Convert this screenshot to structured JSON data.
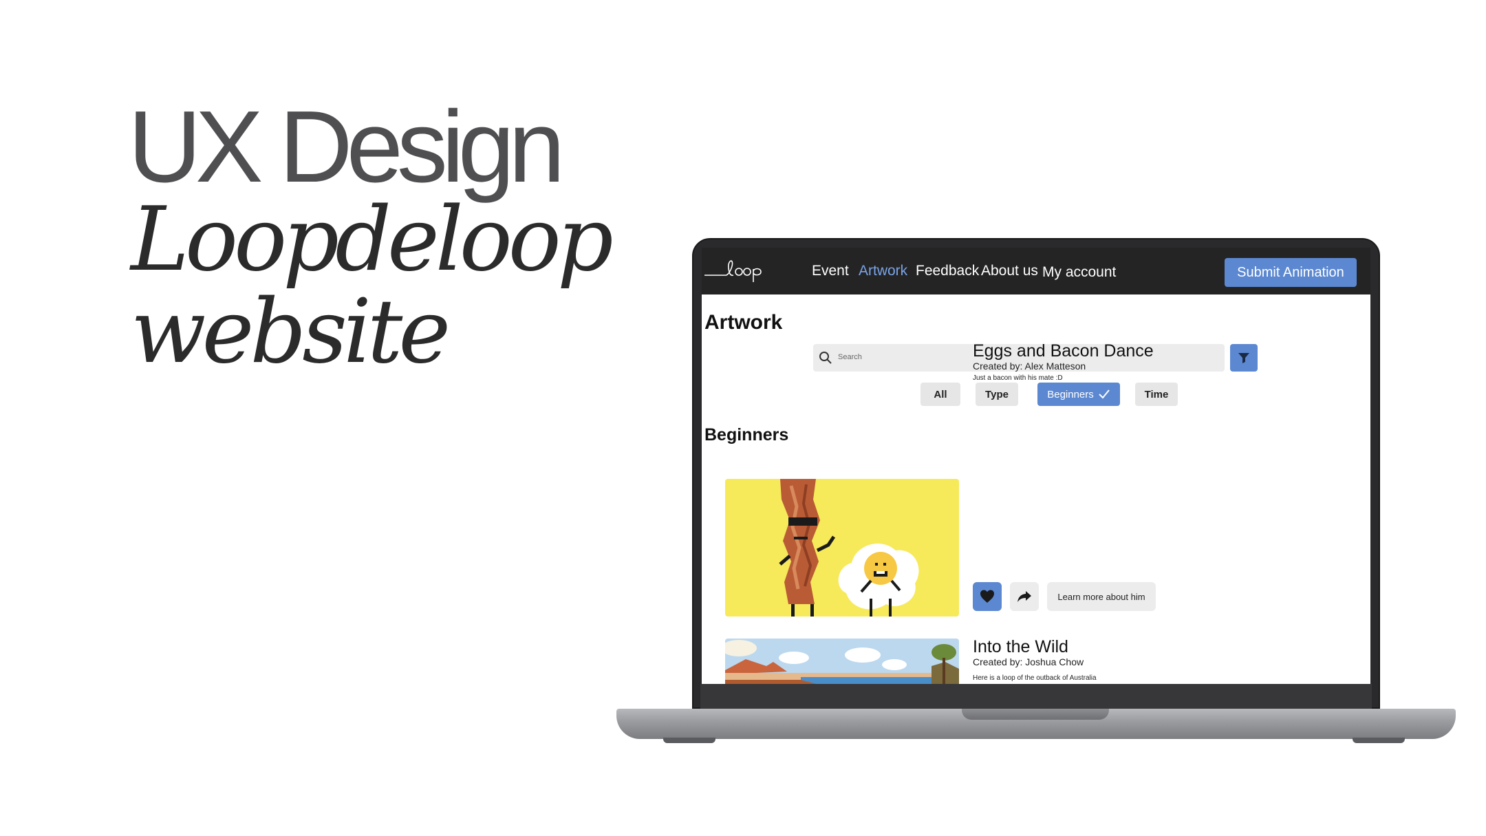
{
  "headline": {
    "ux": "UX Design",
    "project_line1": "Loopdeloop",
    "project_line2": "website"
  },
  "nav": {
    "logo_text": "loop",
    "items": [
      {
        "label": "Event",
        "active": false
      },
      {
        "label": "Artwork",
        "active": true
      },
      {
        "label": "Feedback",
        "active": false
      },
      {
        "label": "About us",
        "active": false
      },
      {
        "label": "My account",
        "active": false
      }
    ],
    "submit_label": "Submit Animation"
  },
  "page": {
    "title": "Artwork",
    "search_placeholder": "Search",
    "filters": [
      {
        "label": "All",
        "selected": false
      },
      {
        "label": "Type",
        "selected": false
      },
      {
        "label": "Beginners",
        "selected": true
      },
      {
        "label": "Time",
        "selected": false
      }
    ],
    "section_title": "Beginners"
  },
  "cards": [
    {
      "title": "Eggs and Bacon Dance",
      "author": "Created by: Alex Matteson",
      "description": "Just a bacon with his mate :D",
      "learn_more_label": "Learn more about him",
      "liked": true
    },
    {
      "title": "Into the Wild",
      "author": "Created by: Joshua Chow",
      "description": "Here is a loop of the outback of Australia"
    }
  ],
  "colors": {
    "accent": "#5c88d1",
    "nav_bg": "#242424",
    "active_nav": "#7aa3e6"
  }
}
